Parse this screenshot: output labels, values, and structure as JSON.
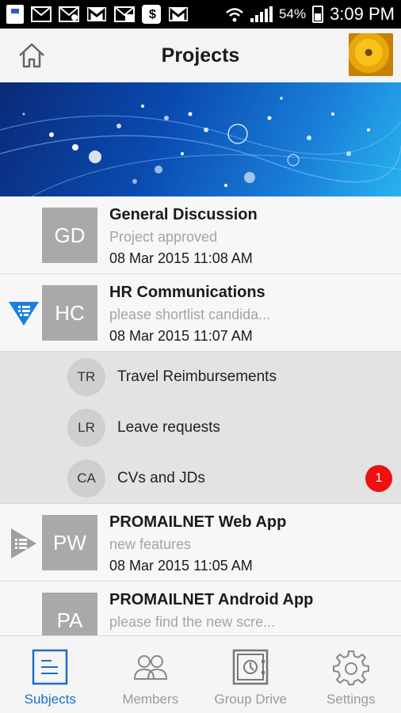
{
  "status_bar": {
    "battery": "54%",
    "time": "3:09 PM"
  },
  "header": {
    "title": "Projects"
  },
  "projects": [
    {
      "initials": "GD",
      "name": "General Discussion",
      "preview": "Project approved",
      "date": "08 Mar 2015 11:08 AM"
    },
    {
      "initials": "HC",
      "name": "HR Communications",
      "preview": "please shortlist candida...",
      "date": "08 Mar 2015 11:07 AM"
    },
    {
      "initials": "PW",
      "name": "PROMAILNET Web App",
      "preview": "new features",
      "date": "08 Mar 2015 11:05 AM"
    },
    {
      "initials": "PA",
      "name": "PROMAILNET Android App",
      "preview": "please find the new scre...",
      "date": ""
    }
  ],
  "subjects": [
    {
      "initials": "TR",
      "label": "Travel Reimbursements"
    },
    {
      "initials": "LR",
      "label": "Leave requests"
    },
    {
      "initials": "CA",
      "label": "CVs and JDs",
      "badge": "1"
    }
  ],
  "tabs": [
    {
      "label": "Subjects"
    },
    {
      "label": "Members"
    },
    {
      "label": "Group Drive"
    },
    {
      "label": "Settings"
    }
  ],
  "colors": {
    "accent": "#1e6ec8",
    "expand_active": "#1a7fe0",
    "expand_inactive": "#9e9e9e",
    "badge": "#ee1111"
  }
}
